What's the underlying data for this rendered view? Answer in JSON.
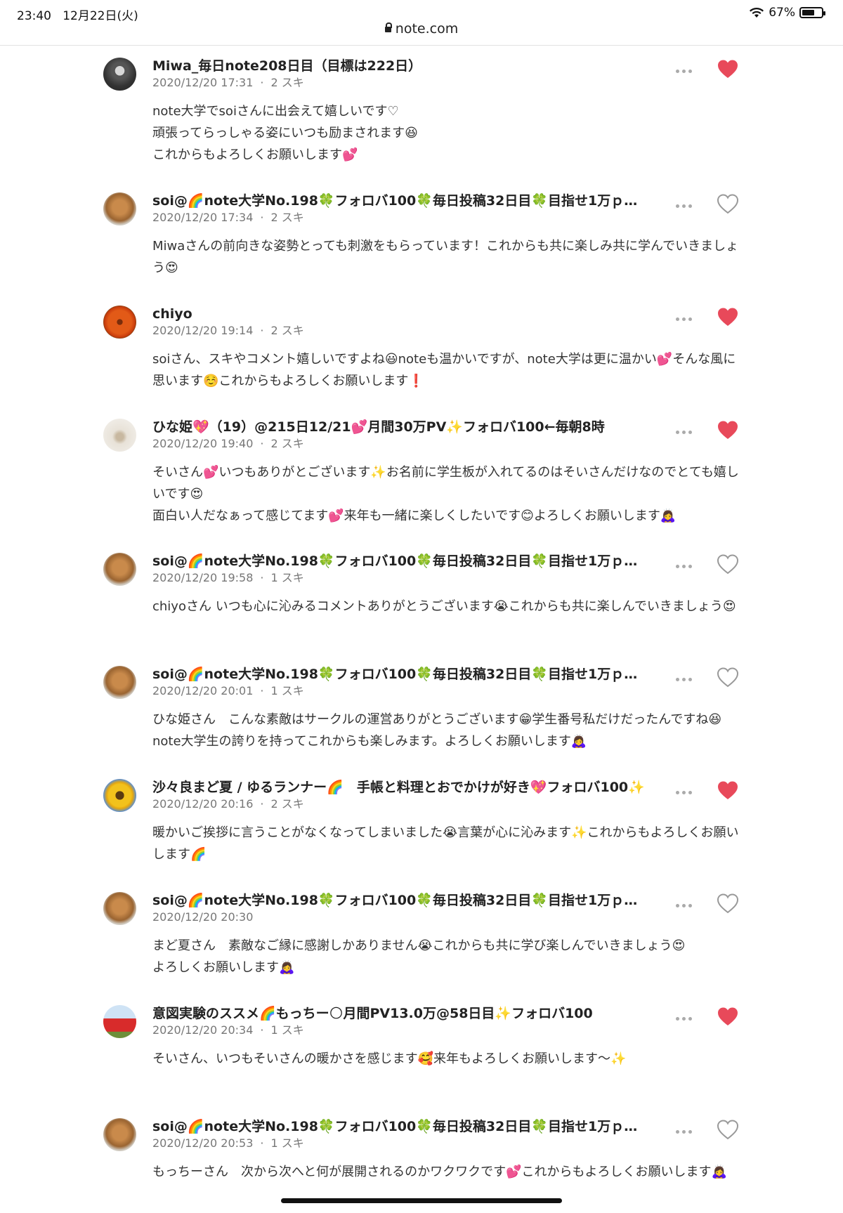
{
  "status": {
    "time": "23:40",
    "date": "12月22日(火)",
    "battery_text": "67%",
    "battery_level": 0.67
  },
  "browser": {
    "url": "note.com"
  },
  "comments": [
    {
      "name": "Miwa_毎日note208日目（目標は222日）",
      "date": "2020/12/20 17:31",
      "likes": "2 スキ",
      "liked": true,
      "lines": [
        "note大学でsoiさんに出会えて嬉しいです♡",
        "頑張ってらっしゃる姿にいつも励まされます😆",
        "これからもよろしくお願いします💕"
      ]
    },
    {
      "name": "soi@🌈note大学No.198🍀フォロバ100🍀毎日投稿32日目🍀目指せ1万ｐ…",
      "date": "2020/12/20 17:34",
      "likes": "2 スキ",
      "liked": false,
      "lines": [
        "Miwaさんの前向きな姿勢とっても刺激をもらっています！これからも共に楽しみ共に学んでいきましょう😍"
      ]
    },
    {
      "name": "chiyo",
      "date": "2020/12/20 19:14",
      "likes": "2 スキ",
      "liked": true,
      "lines": [
        "soiさん、スキやコメント嬉しいですよね😃noteも温かいですが、note大学は更に温かい💕そんな風に思います☺️これからもよろしくお願いします❗"
      ]
    },
    {
      "name": "ひな姫💖（19）@215日12/21💕月間30万PV✨フォロバ100←毎朝8時",
      "date": "2020/12/20 19:40",
      "likes": "2 スキ",
      "liked": true,
      "lines": [
        "そいさん💕いつもありがとございます✨お名前に学生板が入れてるのはそいさんだけなのでとても嬉しいです😍",
        "面白い人だなぁって感じてます💕来年も一緒に楽しくしたいです😊よろしくお願いします🙇‍♀️"
      ]
    },
    {
      "name": "soi@🌈note大学No.198🍀フォロバ100🍀毎日投稿32日目🍀目指せ1万ｐ…",
      "date": "2020/12/20 19:58",
      "likes": "1 スキ",
      "liked": false,
      "lines": [
        "chiyoさん いつも心に沁みるコメントありがとうございます😭これからも共に楽しんでいきましょう😍"
      ]
    },
    {
      "name": "soi@🌈note大学No.198🍀フォロバ100🍀毎日投稿32日目🍀目指せ1万ｐ…",
      "date": "2020/12/20 20:01",
      "likes": "1 スキ",
      "liked": false,
      "lines": [
        "ひな姫さん　こんな素敵はサークルの運営ありがとうございます😁学生番号私だけだったんですね😆note大学生の誇りを持ってこれからも楽しみます。よろしくお願いします🙇‍♀️"
      ]
    },
    {
      "name": "沙々良まど夏 / ゆるランナー🌈　手帳と料理とおでかけが好き💖フォロバ100✨",
      "date": "2020/12/20 20:16",
      "likes": "2 スキ",
      "liked": true,
      "lines": [
        "暖かいご挨拶に言うことがなくなってしまいました😭言葉が心に沁みます✨これからもよろしくお願いします🌈"
      ]
    },
    {
      "name": "soi@🌈note大学No.198🍀フォロバ100🍀毎日投稿32日目🍀目指せ1万ｐ…",
      "date": "2020/12/20 20:30",
      "likes": "",
      "liked": false,
      "lines": [
        "まど夏さん　素敵なご縁に感謝しかありません😭これからも共に学び楽しんでいきましょう😍",
        "よろしくお願いします🙇‍♀️"
      ]
    },
    {
      "name": "意図実験のススメ🌈もっちー🌕月間PV13.0万@58日目✨フォロバ100",
      "date": "2020/12/20 20:34",
      "likes": "1 スキ",
      "liked": true,
      "lines": [
        "そいさん、いつもそいさんの暖かさを感じます🥰来年もよろしくお願いします〜✨"
      ]
    },
    {
      "name": "soi@🌈note大学No.198🍀フォロバ100🍀毎日投稿32日目🍀目指せ1万ｐ…",
      "date": "2020/12/20 20:53",
      "likes": "1 スキ",
      "liked": false,
      "lines": [
        "もっちーさん　次から次へと何が展開されるのかワクワクです💕これからもよろしくお願いします🙇‍♀️"
      ]
    }
  ]
}
